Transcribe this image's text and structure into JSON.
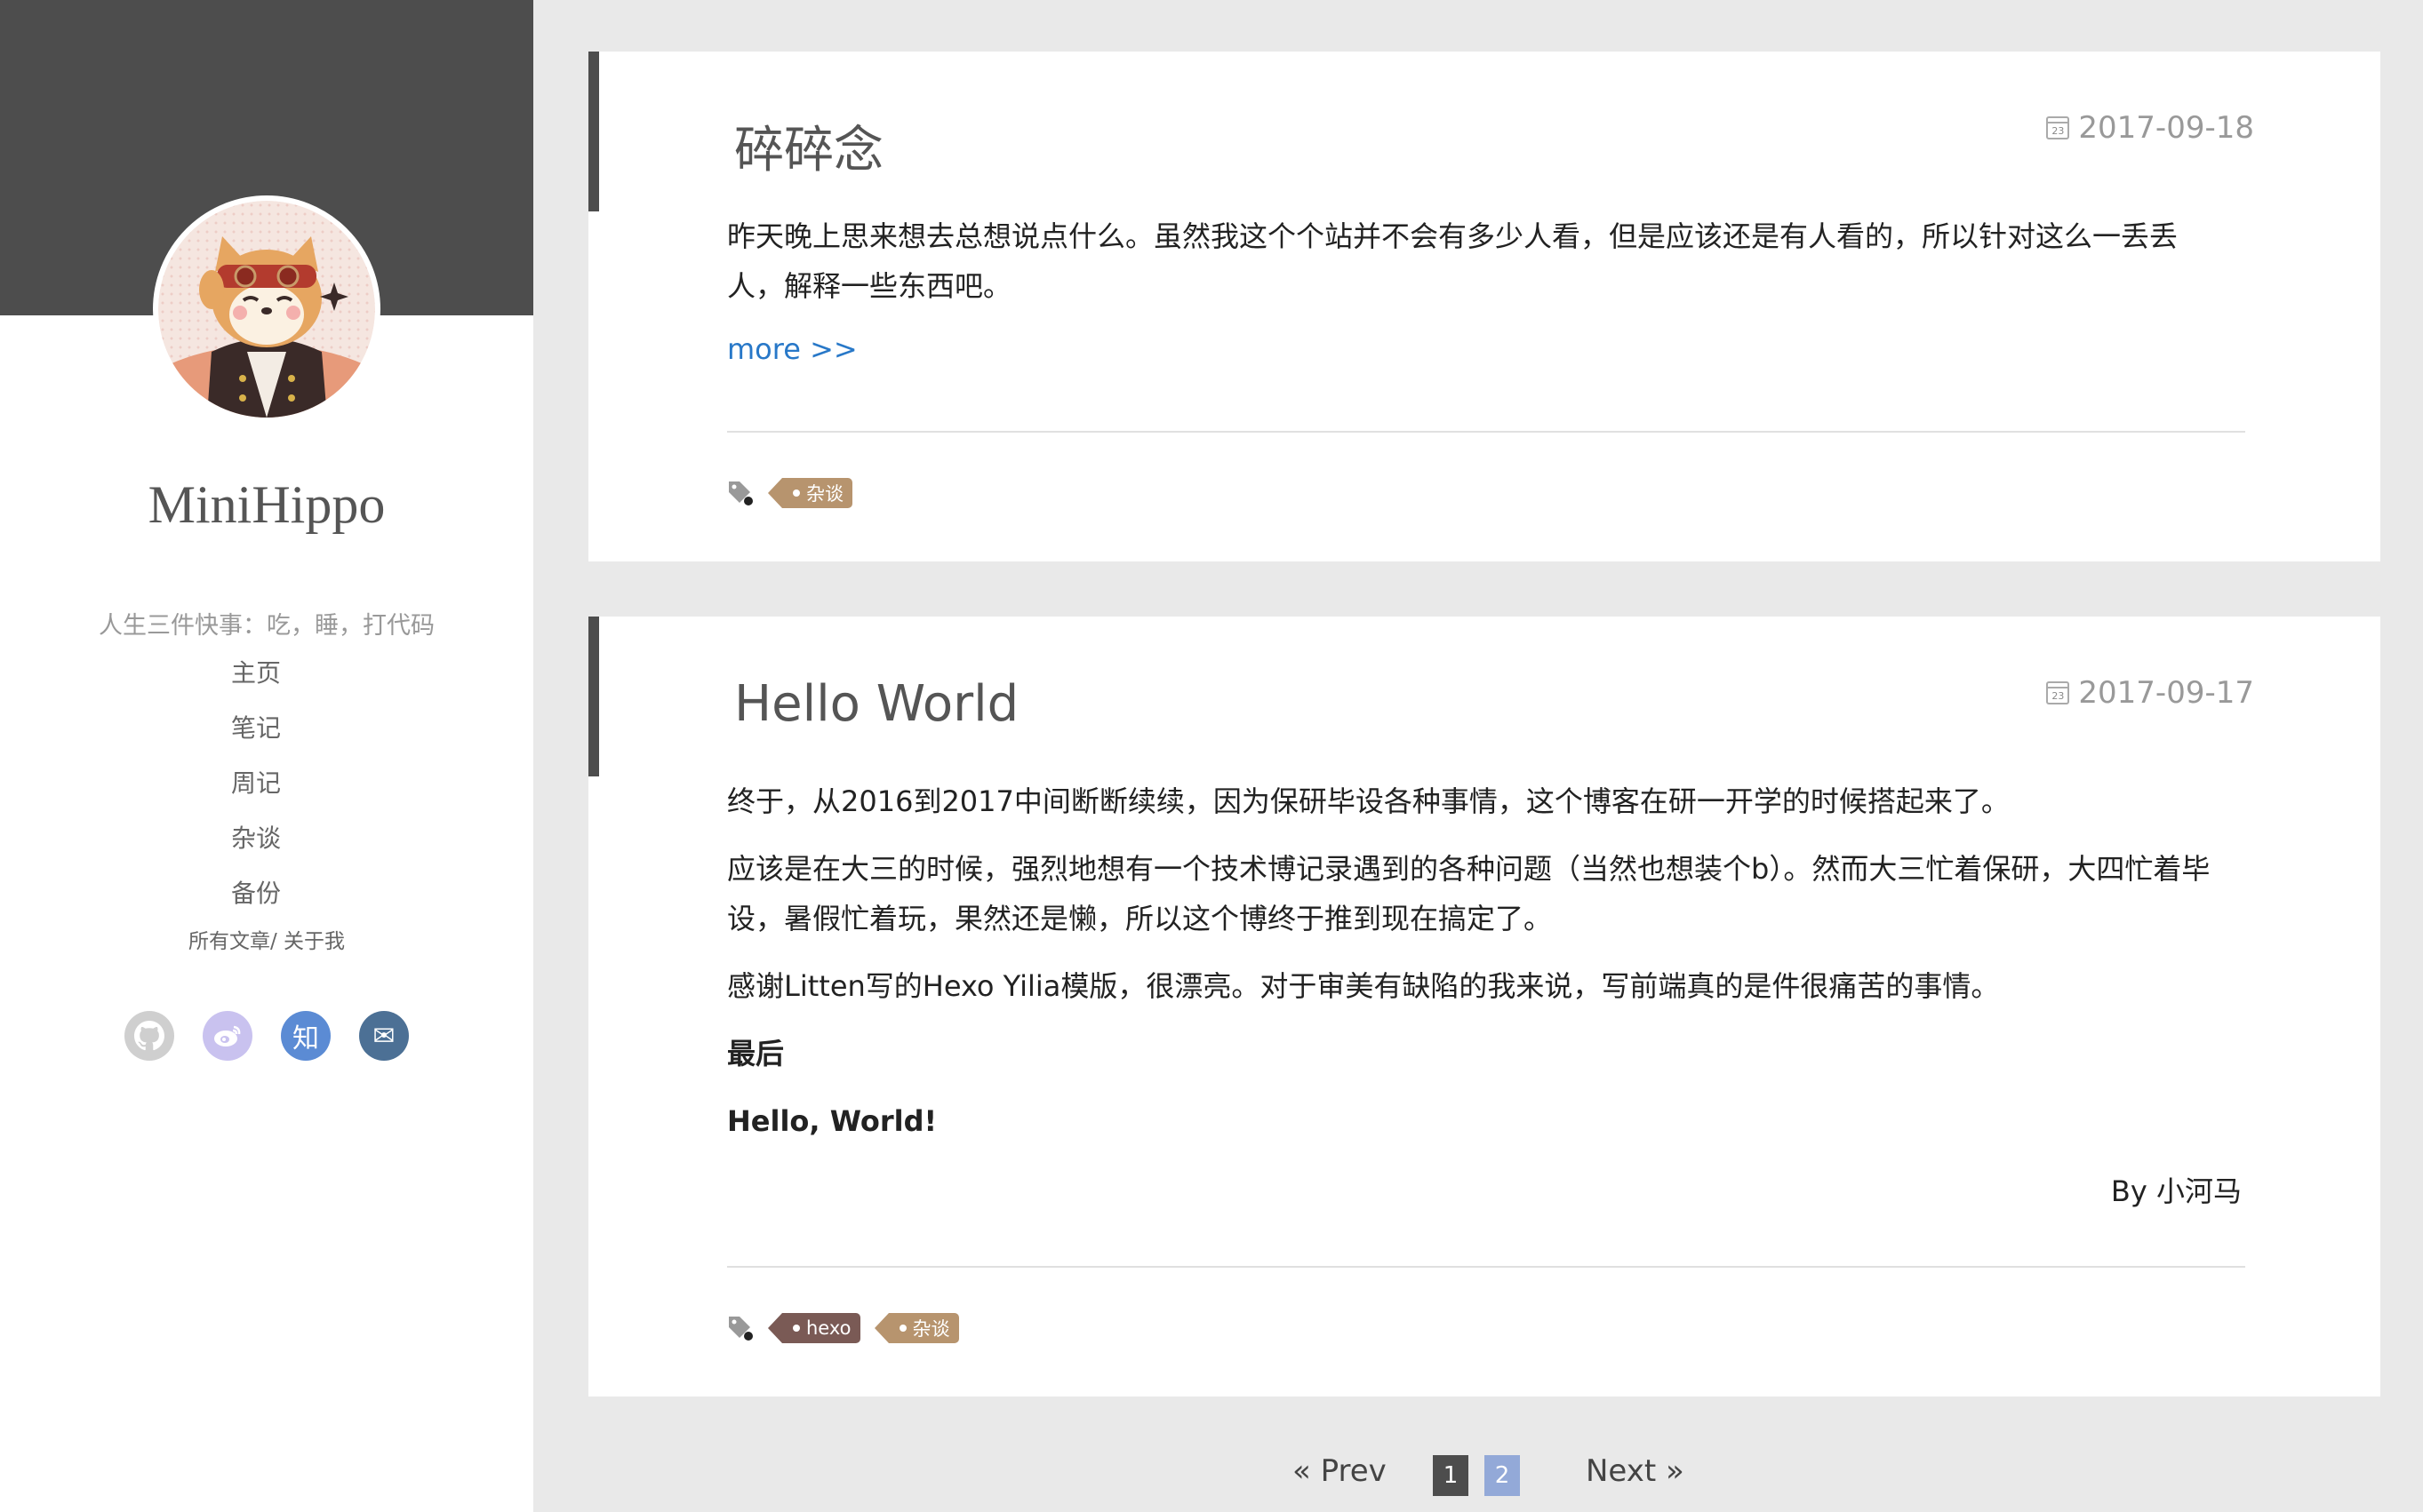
{
  "sidebar": {
    "site_title": "MiniHippo",
    "subtitle": "人生三件快事：吃，睡，打代码",
    "nav": [
      "主页",
      "笔记",
      "周记",
      "杂谈",
      "备份"
    ],
    "all_posts": "所有文章",
    "about": "关于我",
    "social": [
      {
        "name": "github",
        "color": "#cfcfcf",
        "glyph": ""
      },
      {
        "name": "weibo",
        "color": "#c9c2ef",
        "glyph": ""
      },
      {
        "name": "zhihu",
        "color": "#5b8bd4",
        "glyph": "知"
      },
      {
        "name": "mail",
        "color": "#4c7095",
        "glyph": "✉"
      }
    ]
  },
  "posts": [
    {
      "title": "碎碎念",
      "date": "2017-09-18",
      "paragraphs": [
        "昨天晚上思来想去总想说点什么。虽然我这个个站并不会有多少人看，但是应该还是有人看的，所以针对这么一丢丢人，解释一些东西吧。"
      ],
      "more": "more >>",
      "tags": [
        "杂谈"
      ]
    },
    {
      "title": "Hello World",
      "date": "2017-09-17",
      "paragraphs": [
        "终于，从2016到2017中间断断续续，因为保研毕设各种事情，这个博客在研一开学的时候搭起来了。",
        "应该是在大三的时候，强烈地想有一个技术博记录遇到的各种问题（当然也想装个b）。然而大三忙着保研，大四忙着毕设，暑假忙着玩，果然还是懒，所以这个博终于推到现在搞定了。",
        "感谢Litten写的Hexo Yilia模版，很漂亮。对于审美有缺陷的我来说，写前端真的是件很痛苦的事情。"
      ],
      "bold_lines": [
        "最后",
        "Hello, World!"
      ],
      "byline": "By 小河马",
      "tags": [
        "hexo",
        "杂谈"
      ]
    }
  ],
  "pagination": {
    "prev": "« Prev",
    "pages": [
      "1",
      "2"
    ],
    "current": "1",
    "next": "Next »"
  },
  "calendar_icon_text": "23"
}
